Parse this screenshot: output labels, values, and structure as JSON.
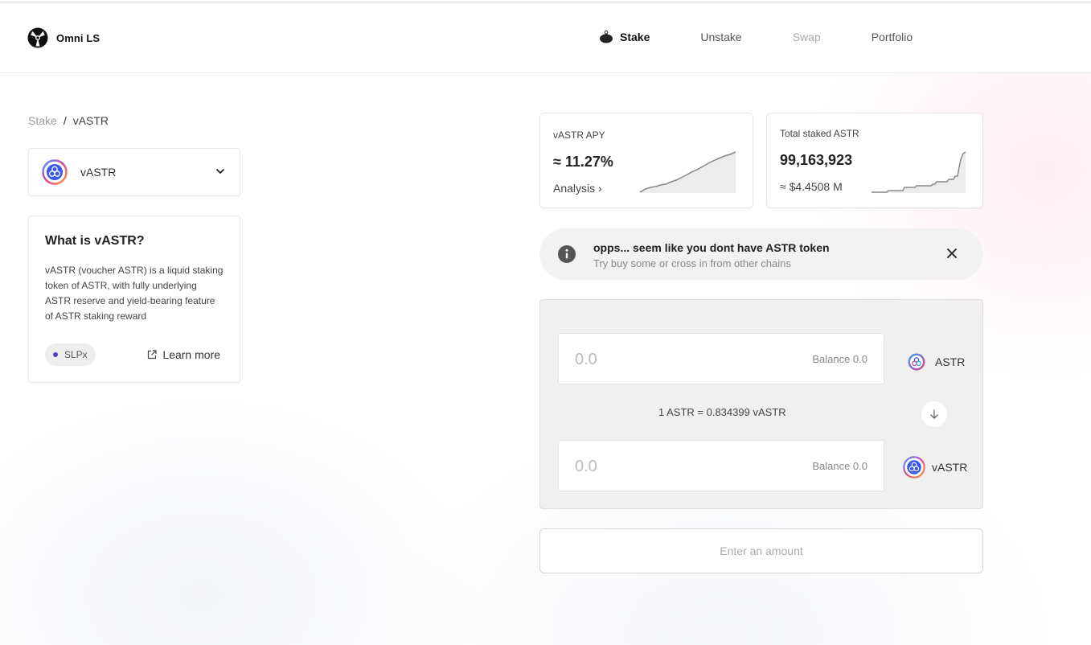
{
  "app": {
    "name": "Omni LS"
  },
  "nav": {
    "stake": "Stake",
    "unstake": "Unstake",
    "swap": "Swap",
    "portfolio": "Portfolio"
  },
  "breadcrumb": {
    "root": "Stake",
    "separator": "/",
    "current": "vASTR"
  },
  "token_select": {
    "selected": "vASTR"
  },
  "info": {
    "title": "What is vASTR?",
    "description": "vASTR (voucher ASTR) is a liquid staking token of ASTR, with fully underlying ASTR reserve and yield-bearing feature of ASTR staking reward",
    "chip": "SLPx",
    "learn_more": "Learn more"
  },
  "stats": {
    "apy": {
      "label": "vASTR APY",
      "value": "≈ 11.27%",
      "link": "Analysis ›"
    },
    "total": {
      "label": "Total staked ASTR",
      "value": "99,163,923",
      "usd": "≈ $4.4508 M"
    }
  },
  "alert": {
    "title": "opps... seem like you dont have ASTR token",
    "subtitle": "Try buy some or cross in from other chains"
  },
  "swap": {
    "from": {
      "placeholder": "0.0",
      "balance": "Balance 0.0",
      "token": "ASTR"
    },
    "rate": "1 ASTR = 0.834399 vASTR",
    "to": {
      "placeholder": "0.0",
      "balance": "Balance 0.0",
      "token": "vASTR"
    }
  },
  "submit": {
    "label": "Enter an amount"
  },
  "colors": {
    "accent": "#5b3cc4",
    "panel": "#f1f0f1",
    "alert_bg": "#f2f2f3"
  },
  "icons": [
    "omni-logo-icon",
    "stake-icon",
    "chevron-down-icon",
    "external-link-icon",
    "info-icon",
    "close-icon",
    "arrow-down-icon",
    "astr-token-icon",
    "vastr-token-icon"
  ]
}
